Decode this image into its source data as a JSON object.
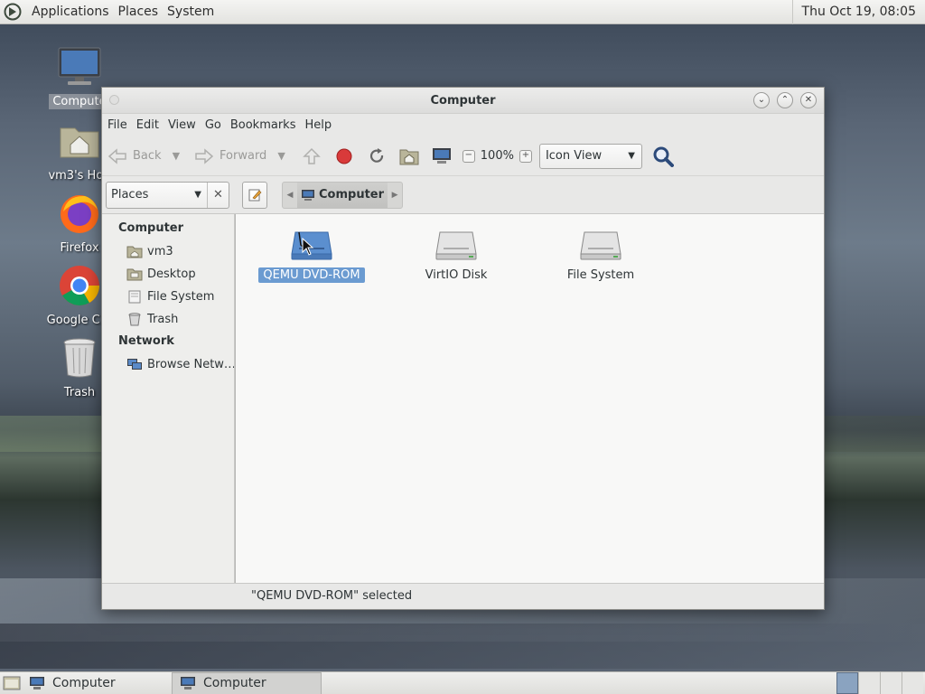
{
  "top_panel": {
    "menus": [
      "Applications",
      "Places",
      "System"
    ],
    "clock": "Thu Oct 19, 08:05"
  },
  "desktop": {
    "icons": [
      {
        "label": "Compute",
        "icon": "monitor-icon"
      },
      {
        "label": "vm3's Hon",
        "icon": "home-folder-icon"
      },
      {
        "label": "Firefox",
        "icon": "firefox-icon"
      },
      {
        "label": "Google Chr",
        "icon": "chrome-icon"
      },
      {
        "label": "Trash",
        "icon": "trash-icon"
      }
    ]
  },
  "window": {
    "title": "Computer",
    "menubar": [
      "File",
      "Edit",
      "View",
      "Go",
      "Bookmarks",
      "Help"
    ],
    "toolbar": {
      "back": "Back",
      "forward": "Forward",
      "zoom": "100%",
      "view_mode": "Icon View"
    },
    "location": {
      "places_label": "Places",
      "crumb": "Computer"
    },
    "sidebar": {
      "sections": [
        {
          "heading": "Computer",
          "items": [
            {
              "label": "vm3",
              "icon": "home-folder-icon"
            },
            {
              "label": "Desktop",
              "icon": "desktop-folder-icon"
            },
            {
              "label": "File System",
              "icon": "drive-icon"
            },
            {
              "label": "Trash",
              "icon": "trash-icon"
            }
          ]
        },
        {
          "heading": "Network",
          "items": [
            {
              "label": "Browse Netw…",
              "icon": "network-icon"
            }
          ]
        }
      ]
    },
    "files": [
      {
        "label": "QEMU DVD-ROM",
        "icon": "optical-drive-icon",
        "selected": true
      },
      {
        "label": "VirtIO Disk",
        "icon": "hard-disk-icon",
        "selected": false
      },
      {
        "label": "File System",
        "icon": "hard-disk-icon",
        "selected": false
      }
    ],
    "status": "\"QEMU DVD-ROM\" selected"
  },
  "taskbar": {
    "tasks": [
      {
        "label": "Computer",
        "active": false
      },
      {
        "label": "Computer",
        "active": true
      }
    ]
  }
}
